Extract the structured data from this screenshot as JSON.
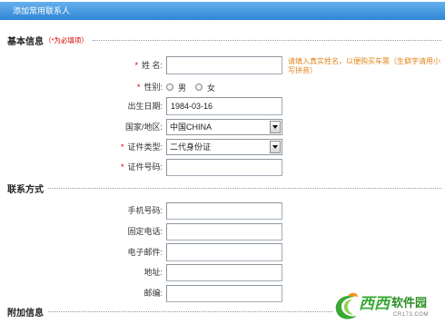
{
  "header": {
    "title": "添加常用联系人"
  },
  "required_mark": "*",
  "basic_info": {
    "title": "基本信息",
    "required_note": "（*为必填项）",
    "name": {
      "label": "姓 名:",
      "value": "",
      "hint": "请填入真实姓名，以便购买车票（生僻字请用小写拼音）"
    },
    "gender": {
      "label": "性别:",
      "options": [
        {
          "label": "男",
          "selected": false
        },
        {
          "label": "女",
          "selected": false
        }
      ]
    },
    "birth_date": {
      "label": "出生日期:",
      "value": "1984-03-16"
    },
    "country": {
      "label": "国家/地区:",
      "value": "中国CHINA"
    },
    "id_type": {
      "label": "证件类型:",
      "value": "二代身份证"
    },
    "id_number": {
      "label": "证件号码:",
      "value": ""
    }
  },
  "contact_info": {
    "title": "联系方式",
    "mobile": {
      "label": "手机号码:",
      "value": ""
    },
    "phone": {
      "label": "固定电话:",
      "value": ""
    },
    "email": {
      "label": "电子邮件:",
      "value": ""
    },
    "address": {
      "label": "地址:",
      "value": ""
    },
    "postcode": {
      "label": "邮编:",
      "value": ""
    }
  },
  "extra_info": {
    "title": "附加信息"
  },
  "watermark": {
    "brand_part1": "西西",
    "brand_part2": "软件园",
    "domain": "CR173.COM"
  },
  "colors": {
    "header_bg_top": "#66b0ee",
    "header_bg_bottom": "#2f86d4",
    "required": "#d40000",
    "hint": "#e0861a",
    "field_border": "#a3acb6",
    "watermark_green": "#3aa935",
    "watermark_dark_green": "#2b8f27",
    "watermark_orange": "#f2951c"
  }
}
